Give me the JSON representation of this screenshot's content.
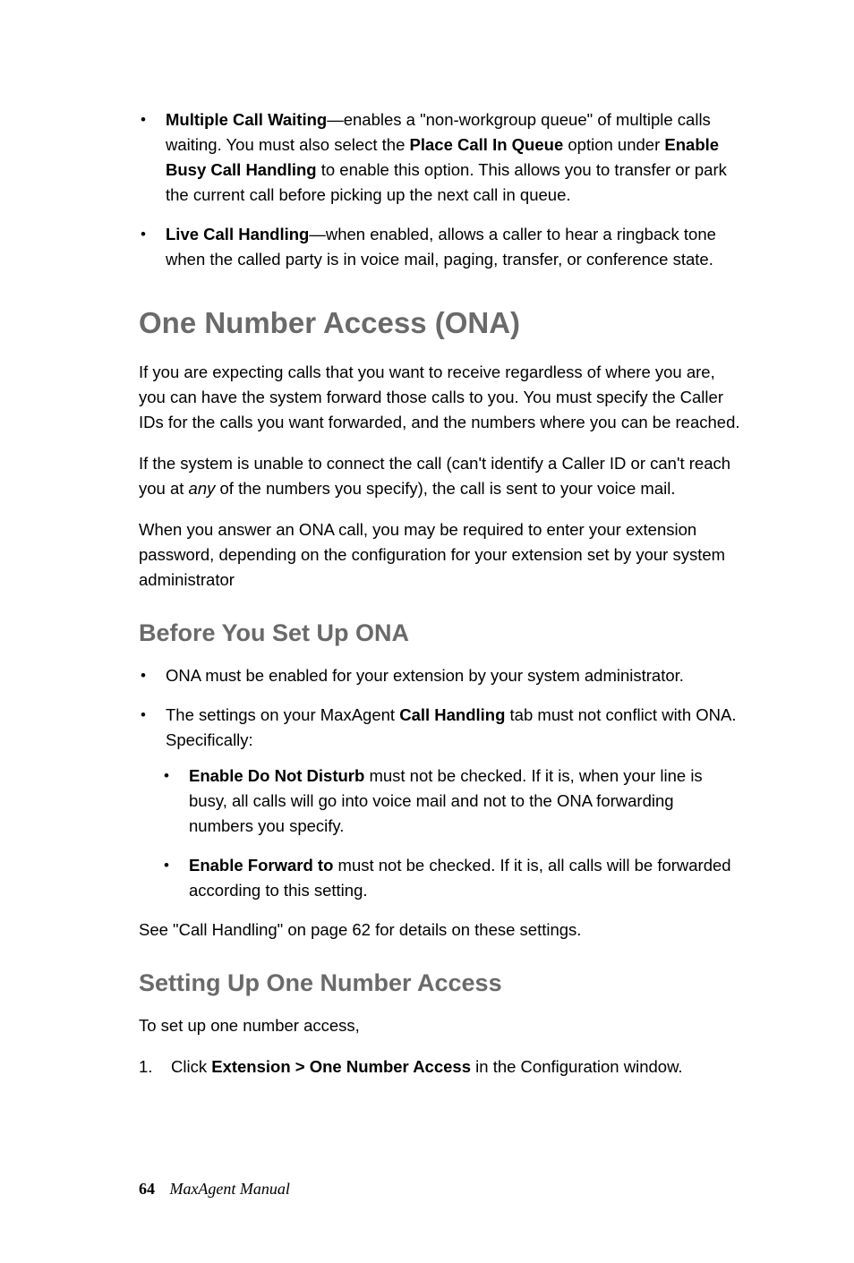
{
  "bullets1": [
    {
      "prefix": "• ",
      "lead": "Multiple Call Waiting",
      "body1": "—enables a \"non-workgroup queue\" of multiple calls waiting. You must also select the ",
      "bold2": "Place Call In Queue",
      "body2": " option under ",
      "bold3": "Enable Busy Call Handling",
      "body3": " to enable this option. This allows you to transfer or park the current call before picking up the next call in queue."
    },
    {
      "prefix": "• ",
      "lead": "Live Call Handling",
      "body1": "—when enabled, allows a caller to hear a ringback tone when the called party is in voice mail, paging, transfer, or conference state."
    }
  ],
  "h1": "One Number Access (ONA)",
  "p1": "If you are expecting calls that you want to receive regardless of where you are, you can have the system forward those calls to you. You must specify the Caller IDs for the calls you want forwarded, and the numbers where you can be reached.",
  "p2": {
    "a": "If the system is unable to connect the call (can't identify a Caller ID or can't reach you at ",
    "i": "any",
    "b": " of the numbers you specify), the call is sent to your voice mail."
  },
  "p3": "When you answer an ONA call, you may be required to enter your extension password, depending on the configuration for your extension set by your system administrator",
  "h2a": "Before You Set Up ONA",
  "bullets2": [
    {
      "text": "ONA must be enabled for your extension by your system administrator."
    },
    {
      "pre": "The settings on your MaxAgent ",
      "b": "Call Handling",
      "post": " tab must not conflict with ONA. Specifically:"
    }
  ],
  "subbullets": [
    {
      "b": "Enable Do Not Disturb",
      "post": " must not be checked. If it is, when your line is busy, all calls will go into voice mail and not to the ONA forwarding numbers you specify."
    },
    {
      "b": "Enable Forward to",
      "post": " must not be checked. If it is, all calls will be forwarded according to this setting."
    }
  ],
  "p4": "See \"Call Handling\" on page 62 for details on these settings.",
  "h2b": "Setting Up One Number Access",
  "p5": "To set up one number access,",
  "ol1": {
    "num": "1.",
    "pre": "Click ",
    "b": "Extension > One Number Access",
    "post": " in the Configuration window."
  },
  "footer": {
    "page": "64",
    "book": "MaxAgent Manual"
  }
}
